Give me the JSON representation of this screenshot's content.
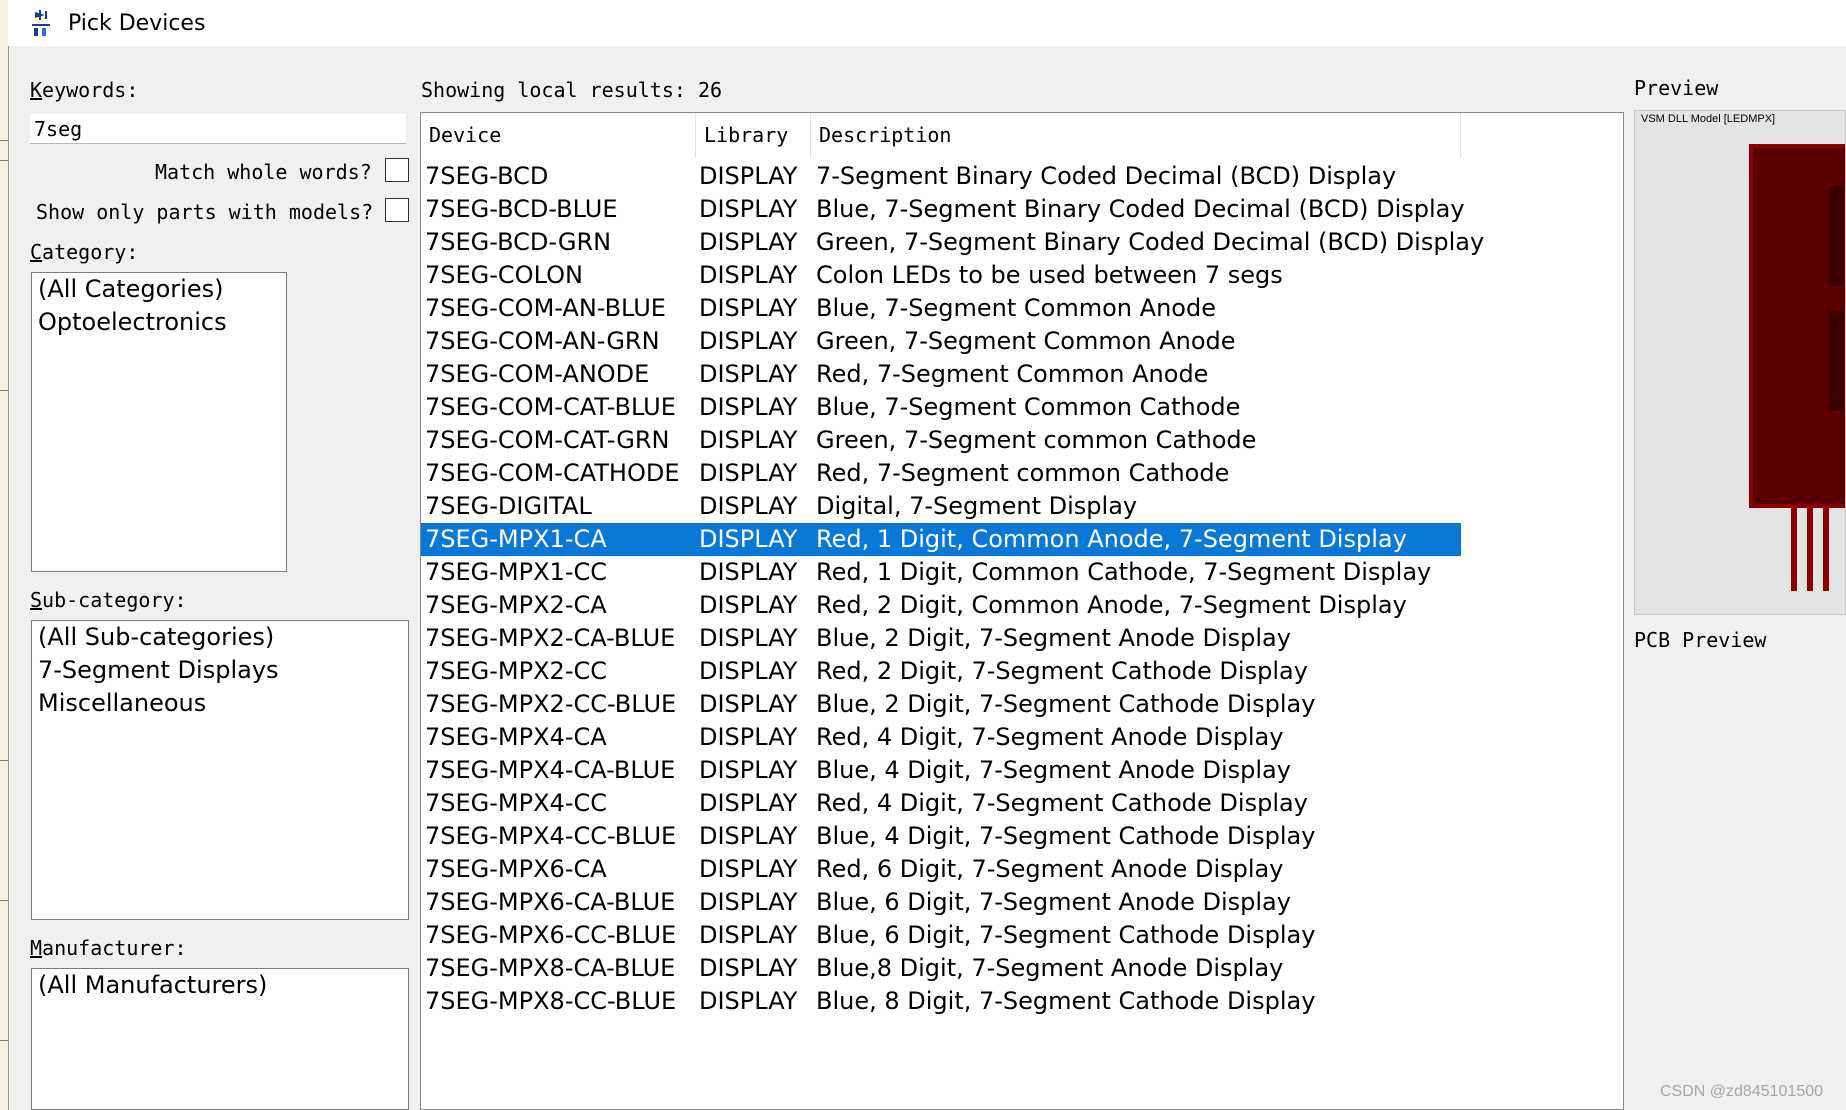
{
  "window": {
    "title": "Pick Devices"
  },
  "filters": {
    "keywords_label": "eywords:",
    "keywords_label_key": "K",
    "keywords_value": "7seg",
    "match_whole_words_label": "Match whole words?",
    "show_models_label": "Show only parts with models?",
    "category_label": "ategory:",
    "category_label_key": "C",
    "categories": [
      "(All Categories)",
      "Optoelectronics"
    ],
    "subcategory_label": "ub-category:",
    "subcategory_label_key": "S",
    "subcategories": [
      "(All Sub-categories)",
      "7-Segment Displays",
      "Miscellaneous"
    ],
    "manufacturer_label": "anufacturer:",
    "manufacturer_label_key": "M",
    "manufacturers": [
      "(All Manufacturers)"
    ]
  },
  "results": {
    "summary": "Showing local results: 26",
    "columns": {
      "device": "Device",
      "library": "Library",
      "description": "Description"
    },
    "selected_index": 11,
    "selected_color": "#0a78d7",
    "rows": [
      {
        "device": "7SEG-BCD",
        "library": "DISPLAY",
        "description": "7-Segment Binary Coded Decimal (BCD) Display"
      },
      {
        "device": "7SEG-BCD-BLUE",
        "library": "DISPLAY",
        "description": "Blue,  7-Segment Binary Coded Decimal (BCD) Display"
      },
      {
        "device": "7SEG-BCD-GRN",
        "library": "DISPLAY",
        "description": "Green, 7-Segment Binary Coded Decimal (BCD) Display"
      },
      {
        "device": "7SEG-COLON",
        "library": "DISPLAY",
        "description": "Colon LEDs to be used between 7 segs"
      },
      {
        "device": "7SEG-COM-AN-BLUE",
        "library": "DISPLAY",
        "description": "Blue, 7-Segment Common Anode"
      },
      {
        "device": "7SEG-COM-AN-GRN",
        "library": "DISPLAY",
        "description": "Green, 7-Segment Common Anode"
      },
      {
        "device": "7SEG-COM-ANODE",
        "library": "DISPLAY",
        "description": "Red, 7-Segment Common Anode"
      },
      {
        "device": "7SEG-COM-CAT-BLUE",
        "library": "DISPLAY",
        "description": "Blue, 7-Segment Common Cathode"
      },
      {
        "device": "7SEG-COM-CAT-GRN",
        "library": "DISPLAY",
        "description": "Green, 7-Segment common Cathode"
      },
      {
        "device": "7SEG-COM-CATHODE",
        "library": "DISPLAY",
        "description": "Red, 7-Segment common Cathode"
      },
      {
        "device": "7SEG-DIGITAL",
        "library": "DISPLAY",
        "description": "Digital, 7-Segment Display"
      },
      {
        "device": "7SEG-MPX1-CA",
        "library": "DISPLAY",
        "description": "Red, 1 Digit, Common Anode, 7-Segment Display"
      },
      {
        "device": "7SEG-MPX1-CC",
        "library": "DISPLAY",
        "description": "Red, 1 Digit, Common Cathode, 7-Segment Display"
      },
      {
        "device": "7SEG-MPX2-CA",
        "library": "DISPLAY",
        "description": "Red, 2 Digit, Common Anode, 7-Segment Display"
      },
      {
        "device": "7SEG-MPX2-CA-BLUE",
        "library": "DISPLAY",
        "description": "Blue, 2 Digit, 7-Segment Anode Display"
      },
      {
        "device": "7SEG-MPX2-CC",
        "library": "DISPLAY",
        "description": "Red, 2 Digit, 7-Segment Cathode Display"
      },
      {
        "device": "7SEG-MPX2-CC-BLUE",
        "library": "DISPLAY",
        "description": "Blue, 2 Digit, 7-Segment Cathode Display"
      },
      {
        "device": "7SEG-MPX4-CA",
        "library": "DISPLAY",
        "description": "Red, 4 Digit, 7-Segment Anode Display"
      },
      {
        "device": "7SEG-MPX4-CA-BLUE",
        "library": "DISPLAY",
        "description": "Blue, 4 Digit, 7-Segment Anode Display"
      },
      {
        "device": "7SEG-MPX4-CC",
        "library": "DISPLAY",
        "description": "Red, 4 Digit, 7-Segment Cathode Display"
      },
      {
        "device": "7SEG-MPX4-CC-BLUE",
        "library": "DISPLAY",
        "description": "Blue, 4 Digit, 7-Segment Cathode Display"
      },
      {
        "device": "7SEG-MPX6-CA",
        "library": "DISPLAY",
        "description": "Red, 6 Digit, 7-Segment Anode Display"
      },
      {
        "device": "7SEG-MPX6-CA-BLUE",
        "library": "DISPLAY",
        "description": "Blue, 6 Digit, 7-Segment Anode Display"
      },
      {
        "device": "7SEG-MPX6-CC-BLUE",
        "library": "DISPLAY",
        "description": "Blue, 6 Digit, 7-Segment Cathode Display"
      },
      {
        "device": "7SEG-MPX8-CA-BLUE",
        "library": "DISPLAY",
        "description": "Blue,8 Digit, 7-Segment Anode Display"
      },
      {
        "device": "7SEG-MPX8-CC-BLUE",
        "library": "DISPLAY",
        "description": "Blue, 8 Digit, 7-Segment Cathode Display"
      }
    ]
  },
  "preview": {
    "label": "Preview",
    "caption": "VSM DLL Model [LEDMPX]",
    "pcb_label": "PCB Preview",
    "segment_color": "#5a0000",
    "frame_color": "#8b0000",
    "pin_color": "#8b0000"
  },
  "watermark": "CSDN @zd845101500",
  "icons": {
    "title": "pick-devices-icon",
    "checkbox": "checkbox-unchecked-icon"
  }
}
